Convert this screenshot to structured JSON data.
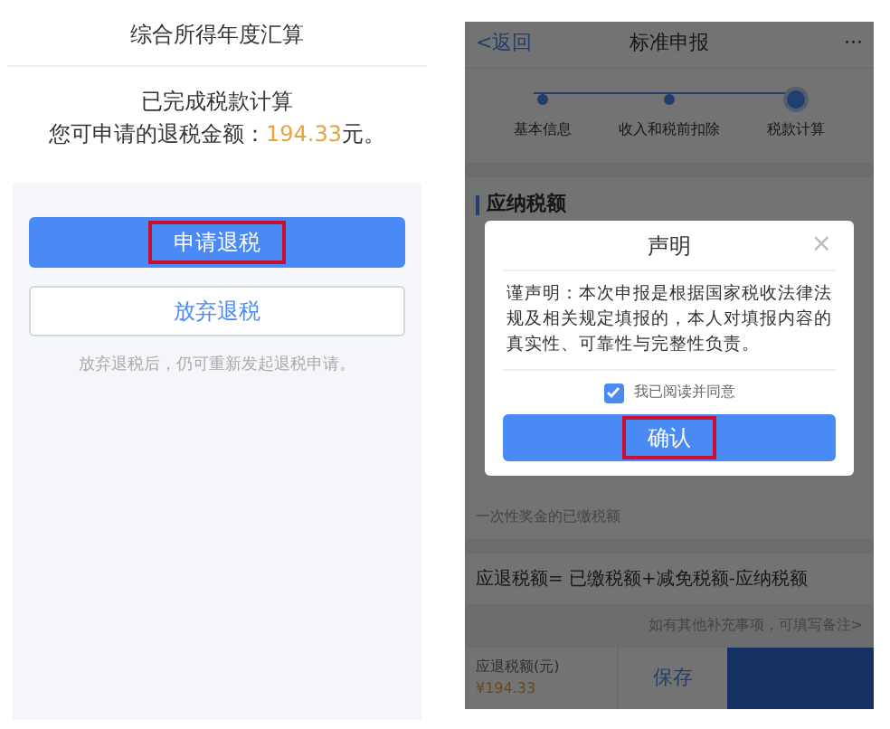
{
  "left_screen": {
    "title": "综合所得年度汇算",
    "status": "已完成税款计算",
    "refund_label": "您可申请的退税金额：",
    "refund_amount": "194.33",
    "refund_unit": "元。",
    "buttons": [
      {
        "label": "申请退税",
        "kind": "primary",
        "highlighted": true
      },
      {
        "label": "放弃退税",
        "kind": "outline",
        "highlighted": false
      }
    ],
    "note": "放弃退税后，仍可重新发起退税申请。"
  },
  "right_screen": {
    "back": "<返回",
    "title": "标准申报",
    "more": "···",
    "steps": [
      {
        "label": "基本信息",
        "selected": false
      },
      {
        "label": "收入和税前扣除",
        "selected": false
      },
      {
        "label": "税款计算",
        "selected": true
      }
    ],
    "section_title": "应纳税额",
    "bonus_row": "一次性奖金的已缴税额",
    "formula": "应退税额= 已缴税额+减免税额-应纳税额",
    "remark_link": "如有其他补充事项，可填写备注>",
    "footer": {
      "label": "应退税额(元)",
      "amount": "¥194.33",
      "save": "保存"
    },
    "dialog": {
      "title": "声明",
      "close": "×",
      "body": "谨声明：本次申报是根据国家税收法律法规及相关规定填报的，本人对填报内容的真实性、可靠性与完整性负责。",
      "agree": {
        "label": "我已阅读并同意",
        "checked": true
      },
      "confirm": {
        "label": "确认",
        "highlighted": true
      }
    }
  }
}
